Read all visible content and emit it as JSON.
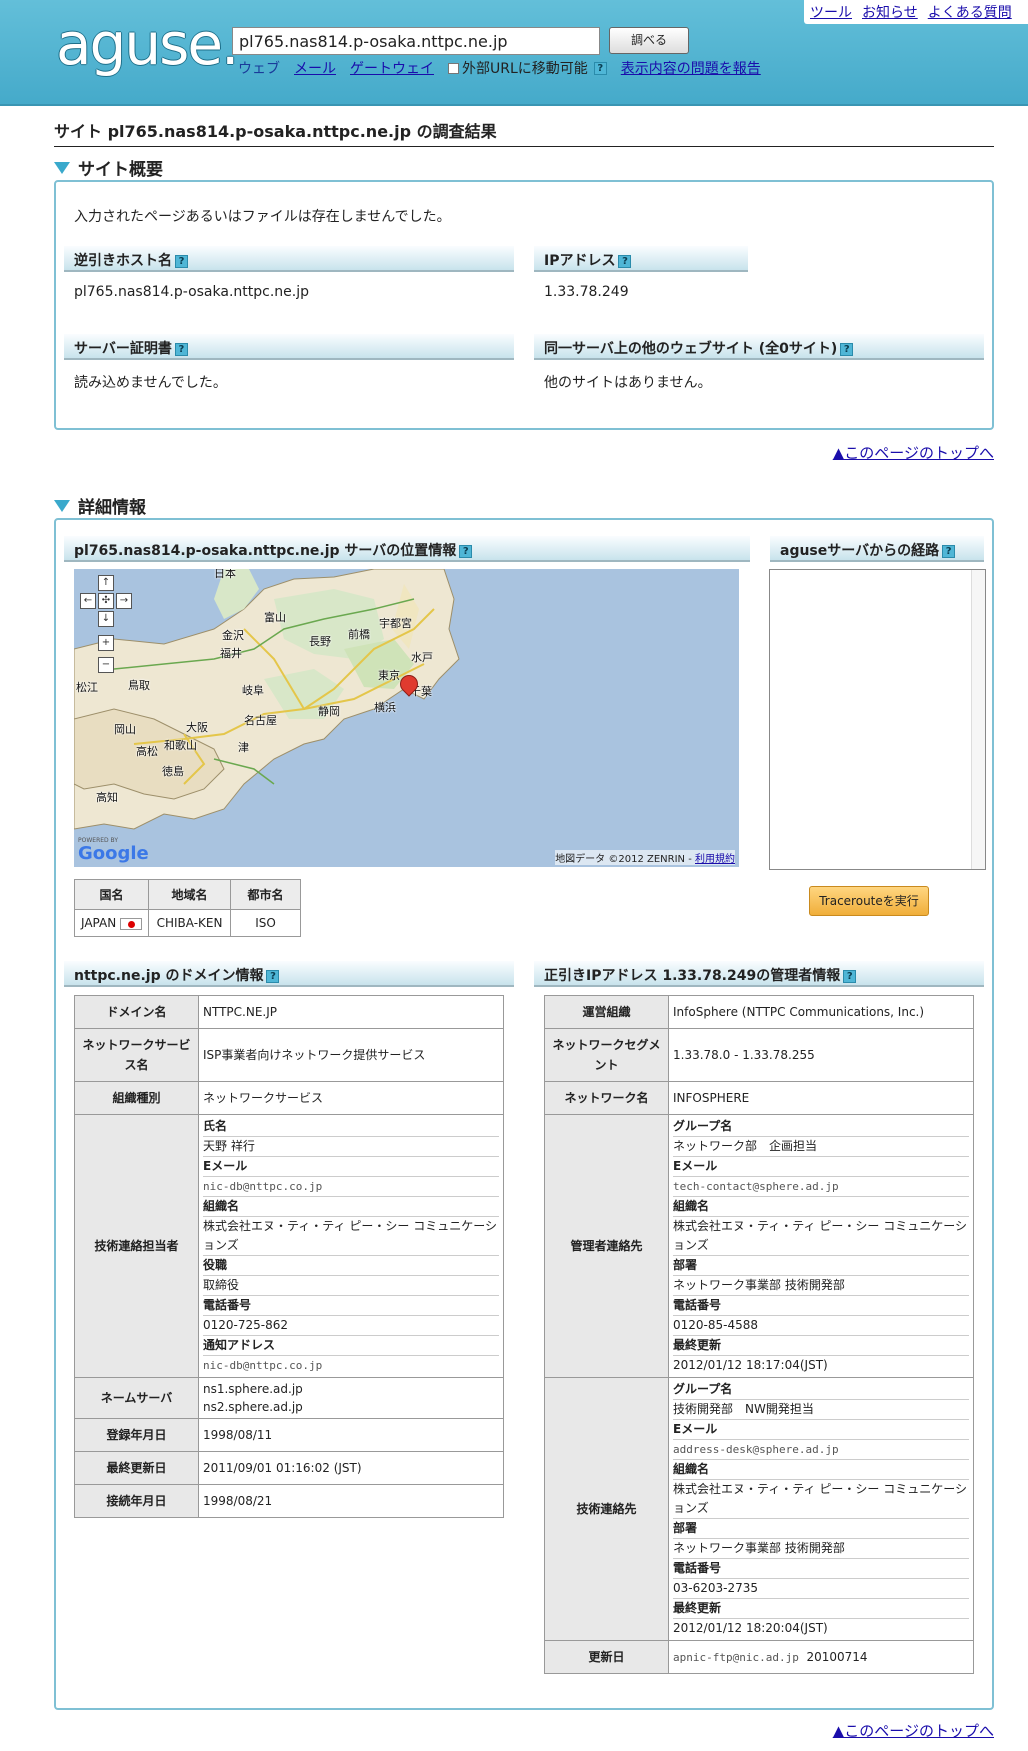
{
  "header": {
    "logo": "aguse.",
    "search_value": "pl765.nas814.p-osaka.nttpc.ne.jp",
    "search_button": "調べる",
    "opt_web": "ウェブ",
    "opt_mail": "メール",
    "opt_gateway": "ゲートウェイ",
    "opt_external": "外部URLに移動可能",
    "report_link": "表示内容の問題を報告",
    "toplinks": [
      "ツール",
      "お知らせ",
      "よくある質問"
    ]
  },
  "page_title": "サイト pl765.nas814.p-osaka.nttpc.ne.jp の調査結果",
  "overview": {
    "heading": "サイト概要",
    "message": "入力されたページあるいはファイルは存在しませんでした。",
    "rhost_label": "逆引きホスト名",
    "rhost_value": "pl765.nas814.p-osaka.nttpc.ne.jp",
    "ip_label": "IPアドレス",
    "ip_value": "1.33.78.249",
    "cert_label": "サーバー証明書",
    "cert_value": "読み込めませんでした。",
    "others_label": "同一サーバ上の他のウェブサイト (全0サイト)",
    "others_value": "他のサイトはありません。"
  },
  "to_top": "▲このページのトップへ",
  "detail": {
    "heading": "詳細情報",
    "location_label": "pl765.nas814.p-osaka.nttpc.ne.jp サーバの位置情報",
    "route_label": "aguseサーバからの経路",
    "traceroute_button": "Tracerouteを実行",
    "map": {
      "labels": [
        "日本",
        "富山",
        "金沢",
        "長野",
        "前橋",
        "宇都宮",
        "福井",
        "水戸",
        "東京",
        "千葉",
        "横浜",
        "岐阜",
        "静岡",
        "松江",
        "鳥取",
        "名古屋",
        "大阪",
        "岡山",
        "和歌山",
        "津",
        "高松",
        "徳島",
        "高知"
      ],
      "attribution": "地図データ ©2012 ZENRIN - ",
      "terms": "利用規約",
      "powered": "POWERED BY",
      "google": "Google"
    },
    "geo_table": {
      "headers": [
        "国名",
        "地域名",
        "都市名"
      ],
      "country": "JAPAN",
      "region": "CHIBA-KEN",
      "city": "ISO"
    }
  },
  "domain_info": {
    "label": "nttpc.ne.jp のドメイン情報",
    "rows": {
      "domain_k": "ドメイン名",
      "domain_v": "NTTPC.NE.JP",
      "netsvc_k": "ネットワークサービス名",
      "netsvc_v": "ISP事業者向けネットワーク提供サービス",
      "org_k": "組織種別",
      "org_v": "ネットワークサービス",
      "tech_k": "技術連絡担当者",
      "ns_k": "ネームサーバ",
      "ns1": "ns1.sphere.ad.jp",
      "ns2": "ns2.sphere.ad.jp",
      "reg_k": "登録年月日",
      "reg_v": "1998/08/11",
      "upd_k": "最終更新日",
      "upd_v": "2011/09/01 01:16:02 (JST)",
      "conn_k": "接続年月日",
      "conn_v": "1998/08/21"
    },
    "tech": {
      "name_k": "氏名",
      "name_v": "天野 祥行",
      "email_k": "Eメール",
      "email_v": "nic-db@nttpc.co.jp",
      "org_k": "組織名",
      "org_v": "株式会社エヌ・ティ・ティ ピー・シー コミュニケーションズ",
      "role_k": "役職",
      "role_v": "取締役",
      "tel_k": "電話番号",
      "tel_v": "0120-725-862",
      "notify_k": "通知アドレス",
      "notify_v": "nic-db@nttpc.co.jp"
    }
  },
  "ip_info": {
    "label": "正引きIPアドレス 1.33.78.249の管理者情報",
    "rows": {
      "op_k": "運営組織",
      "op_v": "InfoSphere (NTTPC Communications, Inc.)",
      "seg_k": "ネットワークセグメント",
      "seg_v": "1.33.78.0 - 1.33.78.255",
      "net_k": "ネットワーク名",
      "net_v": "INFOSPHERE",
      "admin_k": "管理者連絡先",
      "tech_k": "技術連絡先",
      "upd_k": "更新日",
      "upd_mail": "apnic-ftp@nic.ad.jp",
      "upd_v": "20100714"
    },
    "admin": {
      "group_k": "グループ名",
      "group_v": "ネットワーク部　企画担当",
      "email_k": "Eメール",
      "email_v": "tech-contact@sphere.ad.jp",
      "org_k": "組織名",
      "org_v": "株式会社エヌ・ティ・ティ ピー・シー コミュニケーションズ",
      "dept_k": "部署",
      "dept_v": "ネットワーク事業部 技術開発部",
      "tel_k": "電話番号",
      "tel_v": "0120-85-4588",
      "upd_k": "最終更新",
      "upd_v": "2012/01/12 18:17:04(JST)"
    },
    "tech": {
      "group_k": "グループ名",
      "group_v": "技術開発部　NW開発担当",
      "email_k": "Eメール",
      "email_v": "address-desk@sphere.ad.jp",
      "org_k": "組織名",
      "org_v": "株式会社エヌ・ティ・ティ ピー・シー コミュニケーションズ",
      "dept_k": "部署",
      "dept_v": "ネットワーク事業部 技術開発部",
      "tel_k": "電話番号",
      "tel_v": "03-6203-2735",
      "upd_k": "最終更新",
      "upd_v": "2012/01/12 18:20:04(JST)"
    }
  }
}
